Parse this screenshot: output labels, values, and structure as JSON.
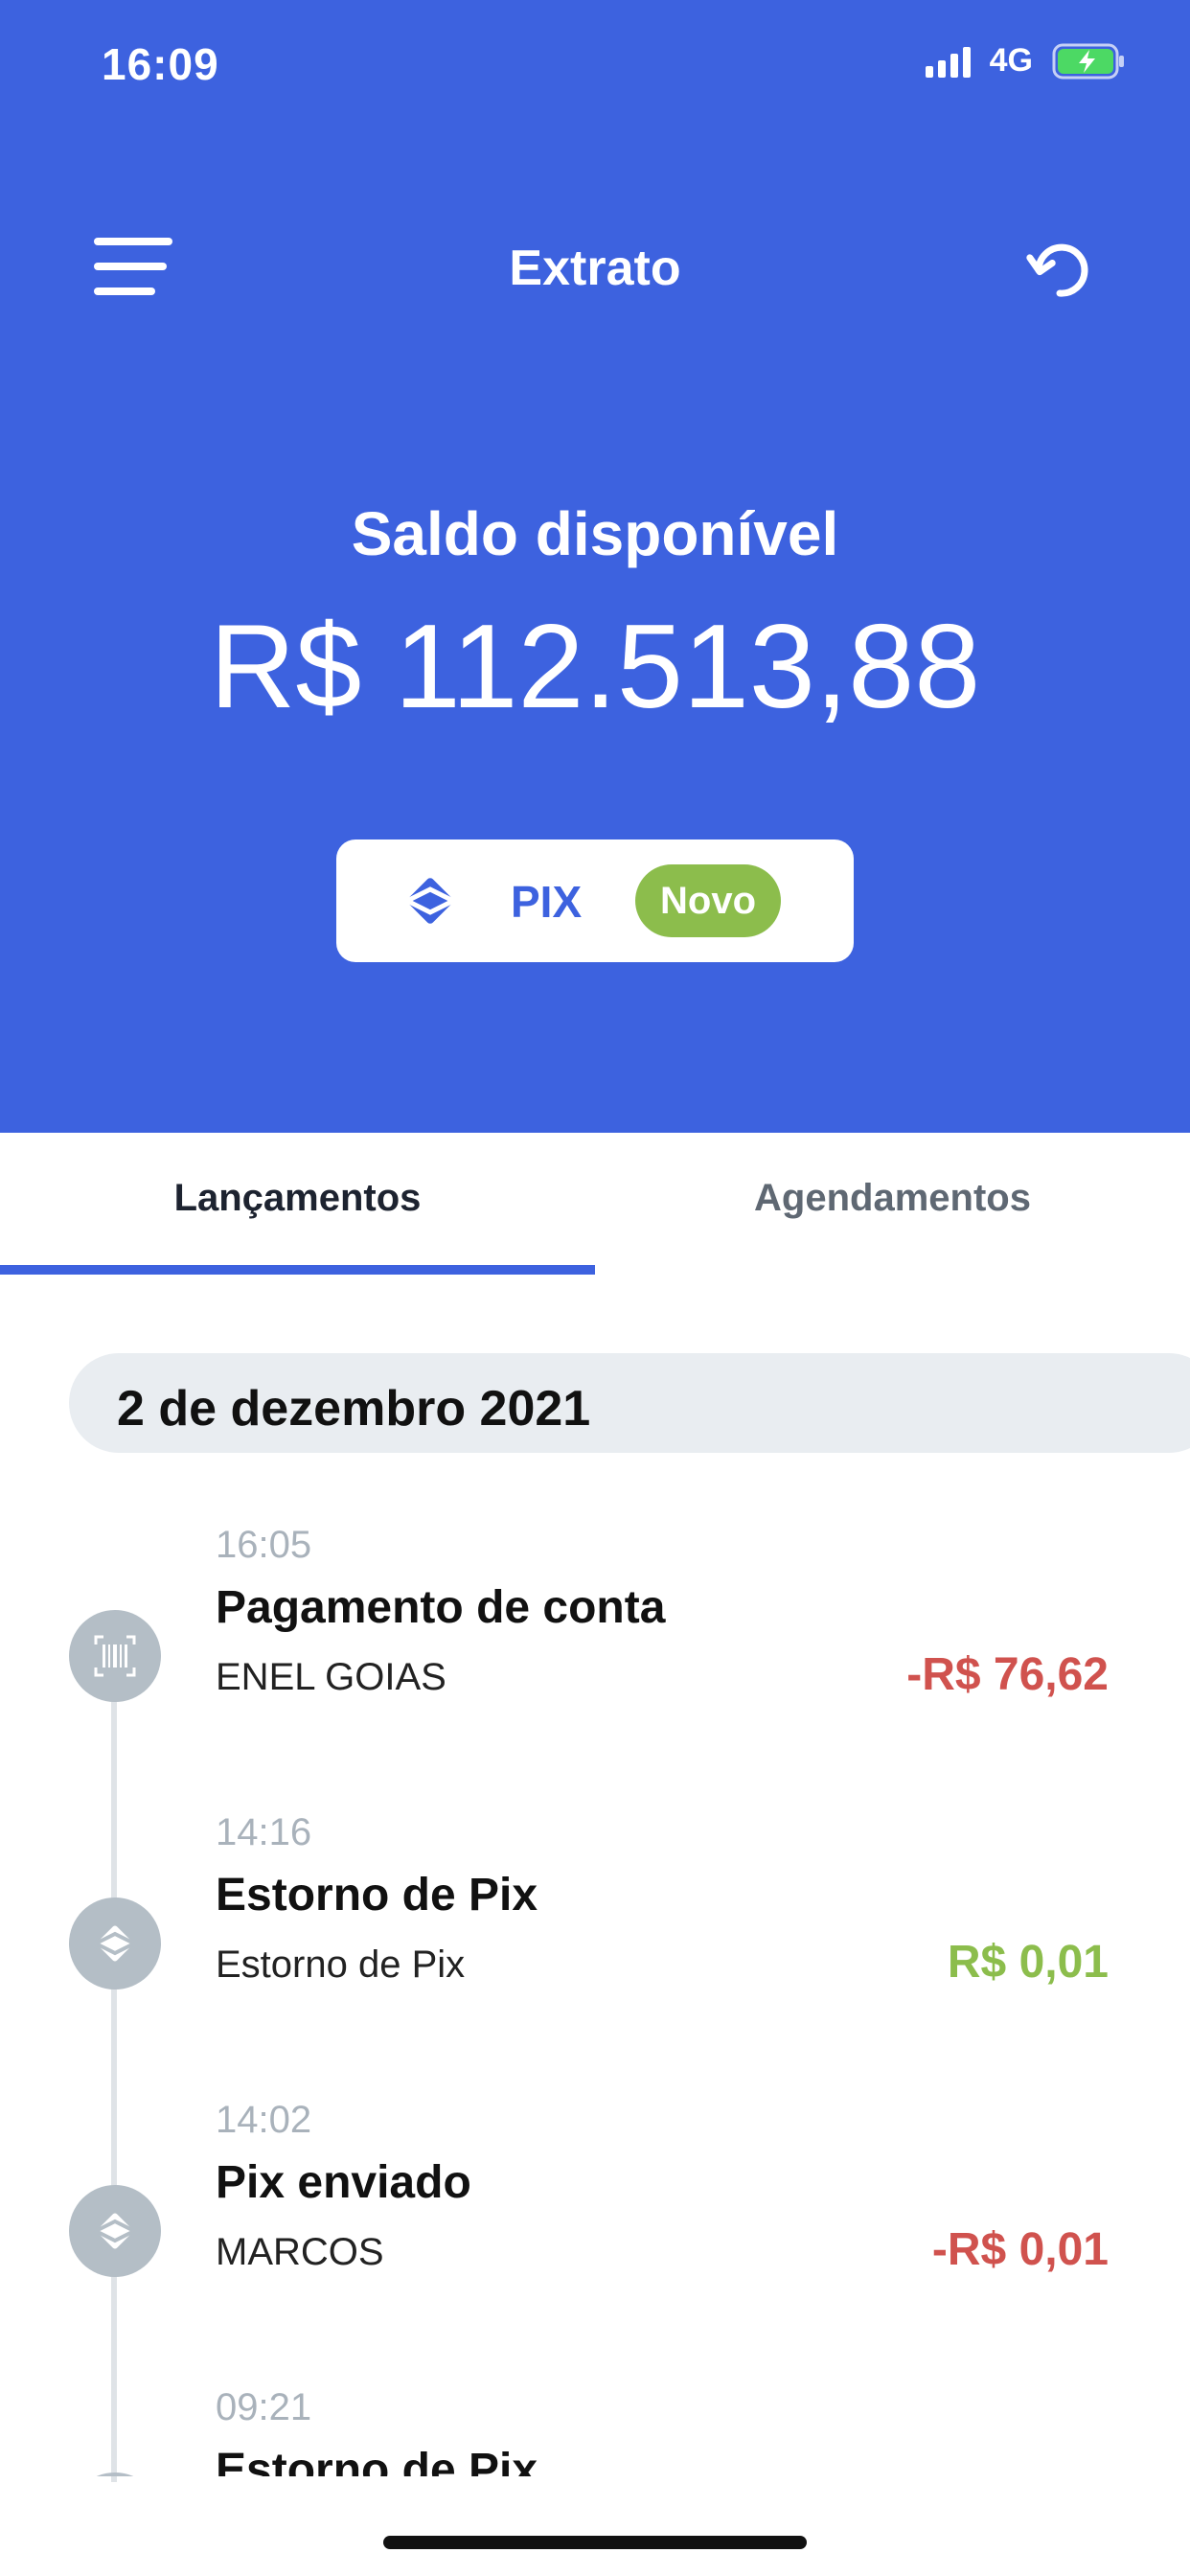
{
  "status_bar": {
    "time": "16:09",
    "network": "4G"
  },
  "header": {
    "title": "Extrato"
  },
  "balance": {
    "label": "Saldo disponível",
    "value": "R$ 112.513,88"
  },
  "pix_button": {
    "label": "PIX",
    "badge": "Novo"
  },
  "tabs": [
    {
      "label": "Lançamentos",
      "active": true
    },
    {
      "label": "Agendamentos",
      "active": false
    }
  ],
  "date_header": "2 de dezembro 2021",
  "transactions": [
    {
      "time": "16:05",
      "title": "Pagamento de conta",
      "subtitle": "ENEL GOIAS",
      "amount": "-R$ 76,62",
      "icon": "barcode-icon",
      "amount_color": "#d0524e"
    },
    {
      "time": "14:16",
      "title": "Estorno de Pix",
      "subtitle": "Estorno de Pix",
      "amount": "R$ 0,01",
      "icon": "pix-icon",
      "amount_color": "#8cbd4c"
    },
    {
      "time": "14:02",
      "title": "Pix enviado",
      "subtitle": "MARCOS",
      "amount": "-R$ 0,01",
      "icon": "pix-icon",
      "amount_color": "#d0524e"
    },
    {
      "time": "09:21",
      "title": "Estorno de Pix",
      "subtitle": "",
      "amount": "",
      "icon": "pix-icon"
    }
  ],
  "colors": {
    "primary": "#3d62df",
    "positive": "#8cbd4c",
    "negative": "#d0524e"
  }
}
